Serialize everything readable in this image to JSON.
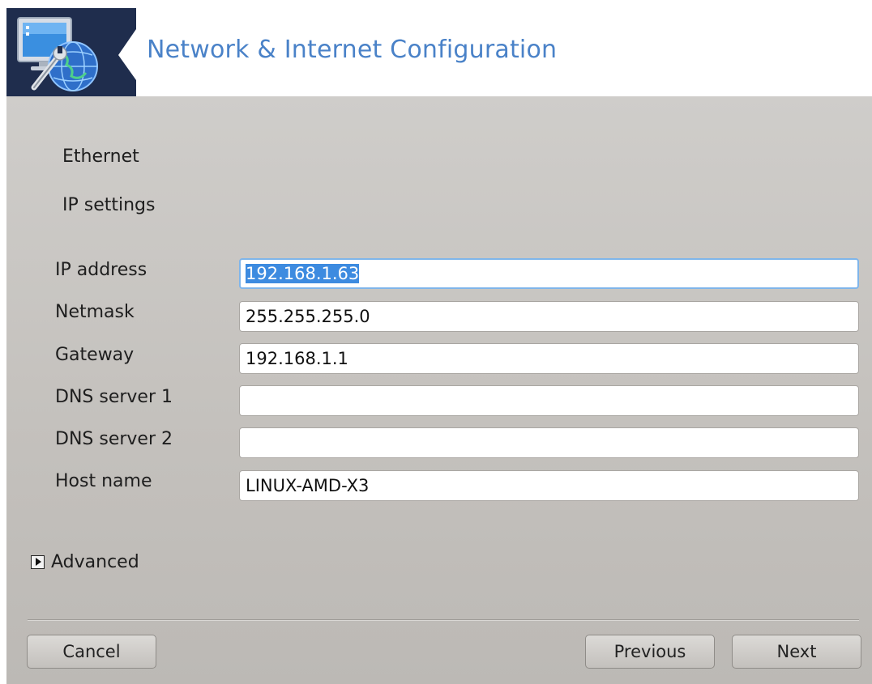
{
  "header": {
    "title": "Network & Internet Configuration",
    "logo_icon": "network-config-icon"
  },
  "section": {
    "connection_type": "Ethernet",
    "subtitle": "IP settings"
  },
  "fields": {
    "ip_address": {
      "label": "IP address",
      "value": "192.168.1.63"
    },
    "netmask": {
      "label": "Netmask",
      "value": "255.255.255.0"
    },
    "gateway": {
      "label": "Gateway",
      "value": "192.168.1.1"
    },
    "dns1": {
      "label": "DNS server 1",
      "value": ""
    },
    "dns2": {
      "label": "DNS server 2",
      "value": ""
    },
    "hostname": {
      "label": "Host name",
      "value": "LINUX-AMD-X3"
    }
  },
  "advanced": {
    "label": "Advanced",
    "expanded": false
  },
  "buttons": {
    "cancel": "Cancel",
    "previous": "Previous",
    "next": "Next"
  },
  "colors": {
    "title": "#4a82c8",
    "logo_bg": "#1f2d4d",
    "focus_border": "#7fb5ea",
    "selection": "#3d8be0"
  }
}
